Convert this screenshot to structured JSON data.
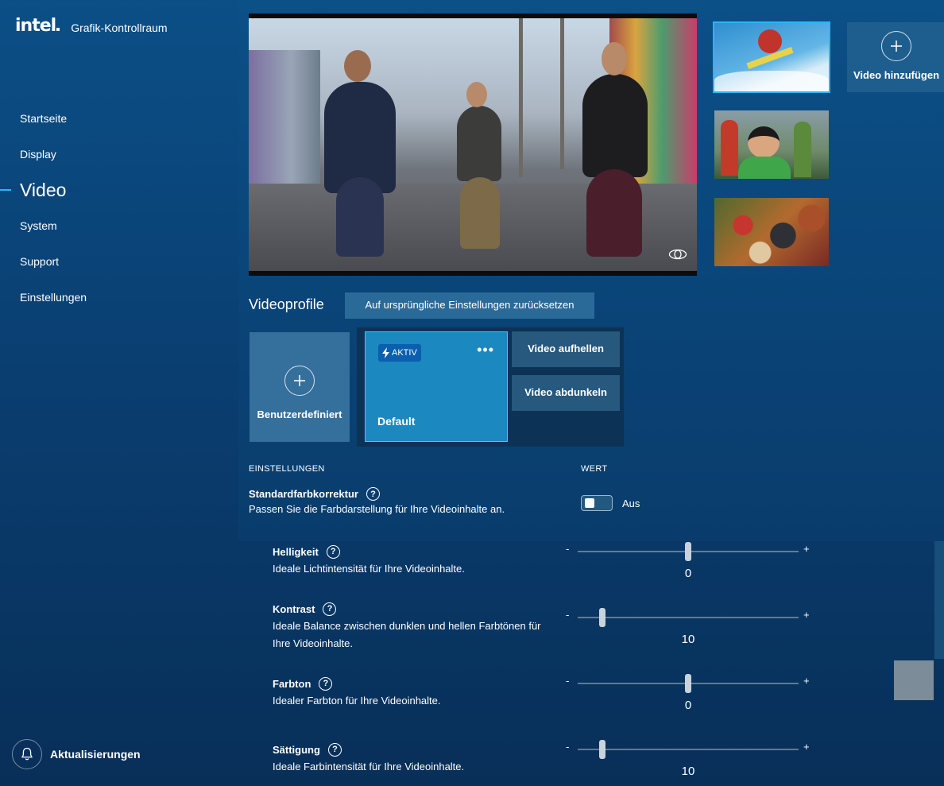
{
  "app": {
    "logo": "intel",
    "title": "Grafik-Kontrollraum"
  },
  "sidebar": {
    "items": [
      {
        "label": "Startseite",
        "active": false
      },
      {
        "label": "Display",
        "active": false
      },
      {
        "label": "Video",
        "active": true
      },
      {
        "label": "System",
        "active": false
      },
      {
        "label": "Support",
        "active": false
      },
      {
        "label": "Einstellungen",
        "active": false
      }
    ],
    "updates_label": "Aktualisierungen"
  },
  "thumbnails": {
    "add_video_label": "Video hinzufügen",
    "selected_index": 0
  },
  "profiles": {
    "title": "Videoprofile",
    "reset_label": "Auf ursprüngliche Einstellungen zurücksetzen",
    "custom_label": "Benutzerdefiniert",
    "active_badge": "AKTIV",
    "default_label": "Default",
    "more_label": "•••",
    "presets": [
      "Video aufhellen",
      "Video abdunkeln"
    ]
  },
  "settings": {
    "col_settings": "EINSTELLUNGEN",
    "col_value": "WERT",
    "help_glyph": "?",
    "standard_color": {
      "title": "Standardfarbkorrektur",
      "desc": "Passen Sie die Farbdarstellung für Ihre Videoinhalte an.",
      "state": "Aus",
      "enabled": false
    },
    "minus": "-",
    "plus": "+",
    "sliders": [
      {
        "title": "Helligkeit",
        "desc": "Ideale Lichtintensität für Ihre Videoinhalte.",
        "value": "0",
        "level": 0.5
      },
      {
        "title": "Kontrast",
        "desc": "Ideale Balance zwischen dunklen und hellen Farbtönen für Ihre Videoinhalte.",
        "value": "10",
        "level": 0.11
      },
      {
        "title": "Farbton",
        "desc": "Idealer Farbton für Ihre Videoinhalte.",
        "value": "0",
        "level": 0.5
      },
      {
        "title": "Sättigung",
        "desc": "Ideale Farbintensität für Ihre Videoinhalte.",
        "value": "10",
        "level": 0.11
      }
    ]
  },
  "colors": {
    "accent": "#29b6f6",
    "active_card": "#1b88c0",
    "badge": "#0a5fae"
  }
}
